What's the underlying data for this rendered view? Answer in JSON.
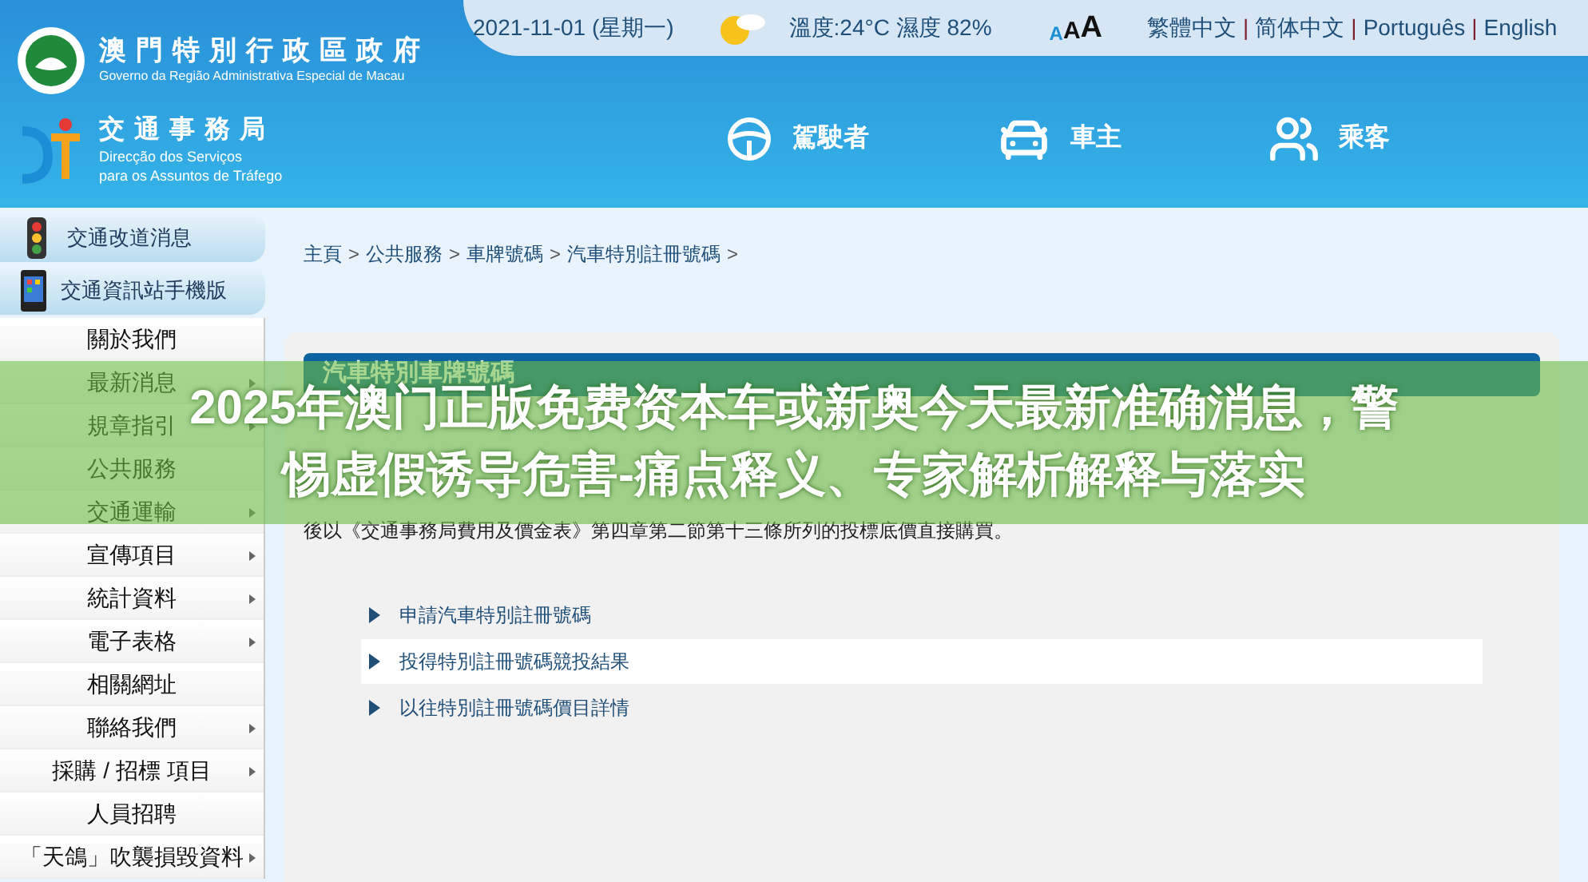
{
  "header": {
    "gov_name": "澳門特別行政區政府",
    "gov_name_pt": "Governo da Região Administrativa Especial de Macau",
    "dept_name": "交通事務局",
    "dept_name_pt_1": "Direcção dos Serviços",
    "dept_name_pt_2": "para os Assuntos de Tráfego",
    "date": "2021-11-01 (星期一)",
    "weather": "溫度:24°C 濕度 82%",
    "font_sizes": [
      "A",
      "A",
      "A"
    ],
    "language_separator": "|",
    "languages": [
      "繁體中文",
      "简体中文",
      "Português",
      "English"
    ],
    "nav": [
      {
        "kind": "wheel",
        "label": "駕駛者"
      },
      {
        "kind": "car",
        "label": "車主"
      },
      {
        "kind": "passengers",
        "label": "乘客"
      }
    ]
  },
  "sidebar": {
    "buttons": [
      {
        "kind": "traffic-light",
        "label": "交通改道消息"
      },
      {
        "kind": "phone",
        "label": "交通資訊站手機版"
      }
    ],
    "items": [
      {
        "label": "關於我們",
        "has_submenu": false
      },
      {
        "label": "最新消息",
        "has_submenu": true
      },
      {
        "label": "規章指引",
        "has_submenu": true
      },
      {
        "label": "公共服務",
        "has_submenu": false
      },
      {
        "label": "交通運輸",
        "has_submenu": true
      },
      {
        "label": "宣傳項目",
        "has_submenu": true
      },
      {
        "label": "統計資料",
        "has_submenu": true
      },
      {
        "label": "電子表格",
        "has_submenu": true
      },
      {
        "label": "相關網址",
        "has_submenu": false
      },
      {
        "label": "聯絡我們",
        "has_submenu": true
      },
      {
        "label": "採購 / 招標 項目",
        "has_submenu": true
      },
      {
        "label": "人員招聘",
        "has_submenu": false
      },
      {
        "label": "「天鴿」吹襲損毀資料",
        "has_submenu": true
      }
    ]
  },
  "breadcrumb": {
    "separator": ">",
    "items": [
      "主頁",
      "公共服務",
      "車牌號碼",
      "汽車特別註冊號碼"
    ]
  },
  "content": {
    "title": "汽車特別車牌號碼",
    "text": "後以《交通事務局費用及價金表》第四章第二節第十三條所列的投標底價直接購買。",
    "links": [
      {
        "label": "申請汽車特別註冊號碼",
        "selected": false
      },
      {
        "label": "投得特別註冊號碼競投結果",
        "selected": true
      },
      {
        "label": "以往特別註冊號碼價目詳情",
        "selected": false
      }
    ]
  },
  "overlay_banner": {
    "lines": [
      "2025年澳门正版免费资本车或新奥今天最新准确消息，警",
      "惕虚假诱导危害-痛点释义、专家解析解释与落实"
    ]
  }
}
